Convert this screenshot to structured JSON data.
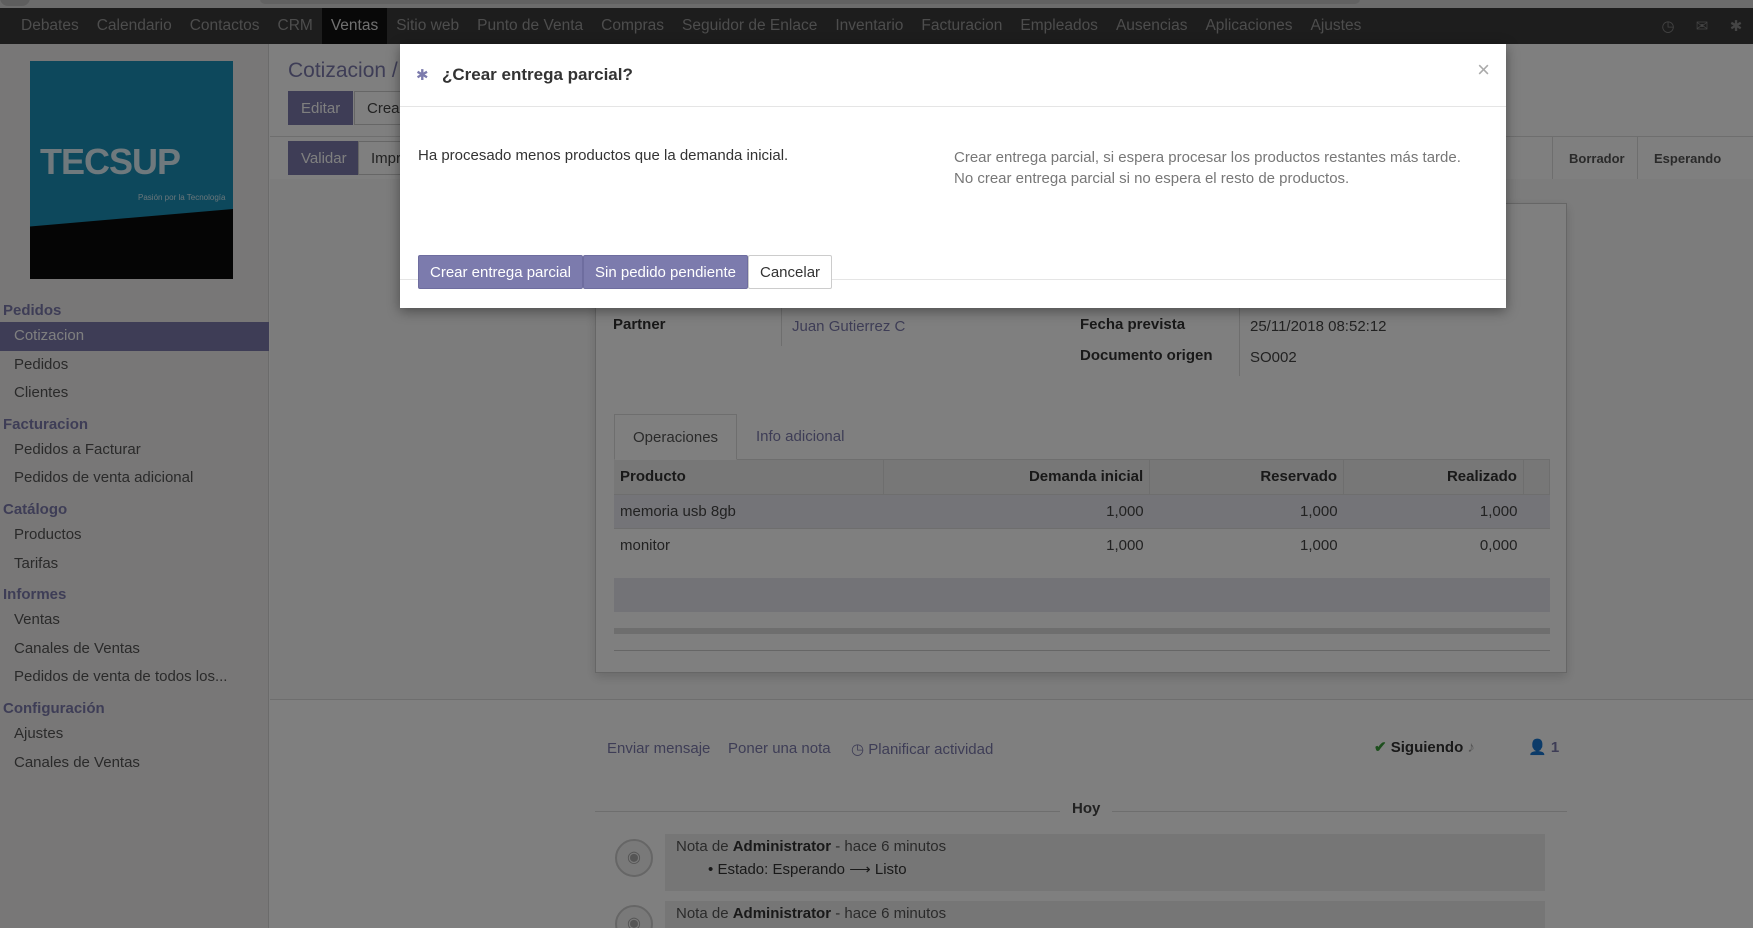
{
  "topbar": {
    "menu": [
      "Debates",
      "Calendario",
      "Contactos",
      "CRM",
      "Ventas",
      "Sitio web",
      "Punto de Venta",
      "Compras",
      "Seguidor de Enlace",
      "Inventario",
      "Facturacion",
      "Empleados",
      "Ausencias",
      "Aplicaciones",
      "Ajustes"
    ],
    "active_index": 4
  },
  "logo": {
    "brand": "TECSUP",
    "tagline": "Pasión por la Tecnología"
  },
  "sidebar": {
    "sections": [
      {
        "title": "Pedidos",
        "items": [
          "Cotizacion",
          "Pedidos",
          "Clientes"
        ]
      },
      {
        "title": "Facturacion",
        "items": [
          "Pedidos a Facturar",
          "Pedidos de venta adicional"
        ]
      },
      {
        "title": "Catálogo",
        "items": [
          "Productos",
          "Tarifas"
        ]
      },
      {
        "title": "Informes",
        "items": [
          "Ventas",
          "Canales de Ventas",
          "Pedidos de venta de todos los..."
        ]
      },
      {
        "title": "Configuración",
        "items": [
          "Ajustes",
          "Canales de Ventas"
        ]
      }
    ],
    "selected": "Cotizacion"
  },
  "control": {
    "breadcrumb": "Cotizacion /",
    "edit": "Editar",
    "create": "Crear",
    "validate": "Validar",
    "print": "Imprimir",
    "stages": [
      "Borrador",
      "Esperando"
    ]
  },
  "form": {
    "partner_label": "Partner",
    "partner_value": "Juan Gutierrez C",
    "date_label": "Fecha prevista",
    "date_value": "25/11/2018 08:52:12",
    "origin_label": "Documento origen",
    "origin_value": "SO002",
    "tabs": [
      "Operaciones",
      "Info adicional"
    ],
    "columns": [
      "Producto",
      "Demanda inicial",
      "Reservado",
      "Realizado"
    ],
    "rows": [
      [
        "memoria usb 8gb",
        "1,000",
        "1,000",
        "1,000"
      ],
      [
        "monitor",
        "1,000",
        "1,000",
        "0,000"
      ]
    ]
  },
  "chatter": {
    "send": "Enviar mensaje",
    "note": "Poner una nota",
    "plan": "Planificar actividad",
    "following": "Siguiendo",
    "followers": "1",
    "today": "Hoy",
    "messages": [
      {
        "prefix": "Nota de",
        "author": "Administrator",
        "time": "- hace 6 minutos",
        "change": "Estado: Esperando ⟶ Listo"
      },
      {
        "prefix": "Nota de",
        "author": "Administrator",
        "time": "- hace 6 minutos"
      }
    ]
  },
  "modal": {
    "title": "¿Crear entrega parcial?",
    "message": "Ha procesado menos productos que la demanda inicial.",
    "help": "Crear entrega parcial, si espera procesar los productos restantes más tarde. No crear entrega parcial si no espera el resto de productos.",
    "btn_partial": "Crear entrega parcial",
    "btn_no_backorder": "Sin pedido pendiente",
    "btn_cancel": "Cancelar",
    "close": "×"
  },
  "colors": {
    "accent": "#7c7bad",
    "topbar": "#3a3a3a"
  }
}
